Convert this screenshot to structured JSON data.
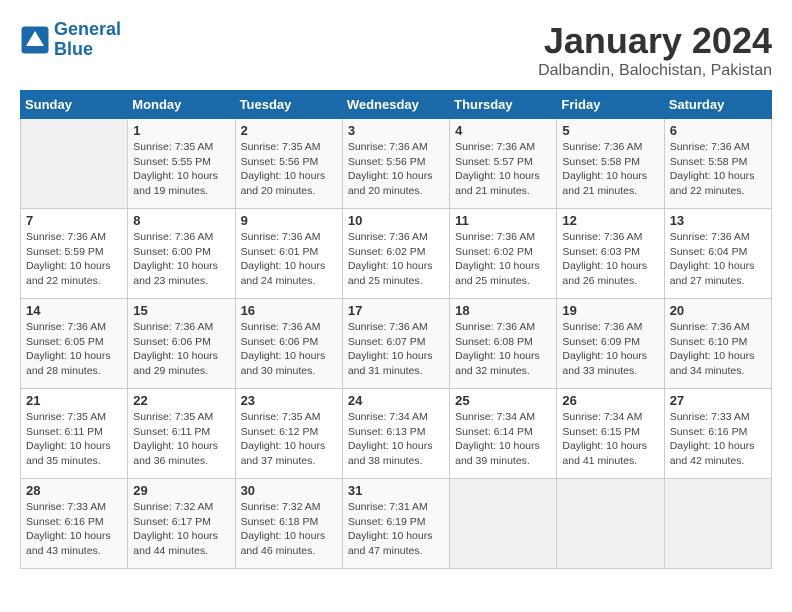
{
  "header": {
    "logo_line1": "General",
    "logo_line2": "Blue",
    "month": "January 2024",
    "location": "Dalbandin, Balochistan, Pakistan"
  },
  "days_of_week": [
    "Sunday",
    "Monday",
    "Tuesday",
    "Wednesday",
    "Thursday",
    "Friday",
    "Saturday"
  ],
  "weeks": [
    [
      {
        "day": "",
        "info": ""
      },
      {
        "day": "1",
        "info": "Sunrise: 7:35 AM\nSunset: 5:55 PM\nDaylight: 10 hours\nand 19 minutes."
      },
      {
        "day": "2",
        "info": "Sunrise: 7:35 AM\nSunset: 5:56 PM\nDaylight: 10 hours\nand 20 minutes."
      },
      {
        "day": "3",
        "info": "Sunrise: 7:36 AM\nSunset: 5:56 PM\nDaylight: 10 hours\nand 20 minutes."
      },
      {
        "day": "4",
        "info": "Sunrise: 7:36 AM\nSunset: 5:57 PM\nDaylight: 10 hours\nand 21 minutes."
      },
      {
        "day": "5",
        "info": "Sunrise: 7:36 AM\nSunset: 5:58 PM\nDaylight: 10 hours\nand 21 minutes."
      },
      {
        "day": "6",
        "info": "Sunrise: 7:36 AM\nSunset: 5:58 PM\nDaylight: 10 hours\nand 22 minutes."
      }
    ],
    [
      {
        "day": "7",
        "info": "Sunrise: 7:36 AM\nSunset: 5:59 PM\nDaylight: 10 hours\nand 22 minutes."
      },
      {
        "day": "8",
        "info": "Sunrise: 7:36 AM\nSunset: 6:00 PM\nDaylight: 10 hours\nand 23 minutes."
      },
      {
        "day": "9",
        "info": "Sunrise: 7:36 AM\nSunset: 6:01 PM\nDaylight: 10 hours\nand 24 minutes."
      },
      {
        "day": "10",
        "info": "Sunrise: 7:36 AM\nSunset: 6:02 PM\nDaylight: 10 hours\nand 25 minutes."
      },
      {
        "day": "11",
        "info": "Sunrise: 7:36 AM\nSunset: 6:02 PM\nDaylight: 10 hours\nand 25 minutes."
      },
      {
        "day": "12",
        "info": "Sunrise: 7:36 AM\nSunset: 6:03 PM\nDaylight: 10 hours\nand 26 minutes."
      },
      {
        "day": "13",
        "info": "Sunrise: 7:36 AM\nSunset: 6:04 PM\nDaylight: 10 hours\nand 27 minutes."
      }
    ],
    [
      {
        "day": "14",
        "info": "Sunrise: 7:36 AM\nSunset: 6:05 PM\nDaylight: 10 hours\nand 28 minutes."
      },
      {
        "day": "15",
        "info": "Sunrise: 7:36 AM\nSunset: 6:06 PM\nDaylight: 10 hours\nand 29 minutes."
      },
      {
        "day": "16",
        "info": "Sunrise: 7:36 AM\nSunset: 6:06 PM\nDaylight: 10 hours\nand 30 minutes."
      },
      {
        "day": "17",
        "info": "Sunrise: 7:36 AM\nSunset: 6:07 PM\nDaylight: 10 hours\nand 31 minutes."
      },
      {
        "day": "18",
        "info": "Sunrise: 7:36 AM\nSunset: 6:08 PM\nDaylight: 10 hours\nand 32 minutes."
      },
      {
        "day": "19",
        "info": "Sunrise: 7:36 AM\nSunset: 6:09 PM\nDaylight: 10 hours\nand 33 minutes."
      },
      {
        "day": "20",
        "info": "Sunrise: 7:36 AM\nSunset: 6:10 PM\nDaylight: 10 hours\nand 34 minutes."
      }
    ],
    [
      {
        "day": "21",
        "info": "Sunrise: 7:35 AM\nSunset: 6:11 PM\nDaylight: 10 hours\nand 35 minutes."
      },
      {
        "day": "22",
        "info": "Sunrise: 7:35 AM\nSunset: 6:11 PM\nDaylight: 10 hours\nand 36 minutes."
      },
      {
        "day": "23",
        "info": "Sunrise: 7:35 AM\nSunset: 6:12 PM\nDaylight: 10 hours\nand 37 minutes."
      },
      {
        "day": "24",
        "info": "Sunrise: 7:34 AM\nSunset: 6:13 PM\nDaylight: 10 hours\nand 38 minutes."
      },
      {
        "day": "25",
        "info": "Sunrise: 7:34 AM\nSunset: 6:14 PM\nDaylight: 10 hours\nand 39 minutes."
      },
      {
        "day": "26",
        "info": "Sunrise: 7:34 AM\nSunset: 6:15 PM\nDaylight: 10 hours\nand 41 minutes."
      },
      {
        "day": "27",
        "info": "Sunrise: 7:33 AM\nSunset: 6:16 PM\nDaylight: 10 hours\nand 42 minutes."
      }
    ],
    [
      {
        "day": "28",
        "info": "Sunrise: 7:33 AM\nSunset: 6:16 PM\nDaylight: 10 hours\nand 43 minutes."
      },
      {
        "day": "29",
        "info": "Sunrise: 7:32 AM\nSunset: 6:17 PM\nDaylight: 10 hours\nand 44 minutes."
      },
      {
        "day": "30",
        "info": "Sunrise: 7:32 AM\nSunset: 6:18 PM\nDaylight: 10 hours\nand 46 minutes."
      },
      {
        "day": "31",
        "info": "Sunrise: 7:31 AM\nSunset: 6:19 PM\nDaylight: 10 hours\nand 47 minutes."
      },
      {
        "day": "",
        "info": ""
      },
      {
        "day": "",
        "info": ""
      },
      {
        "day": "",
        "info": ""
      }
    ]
  ]
}
